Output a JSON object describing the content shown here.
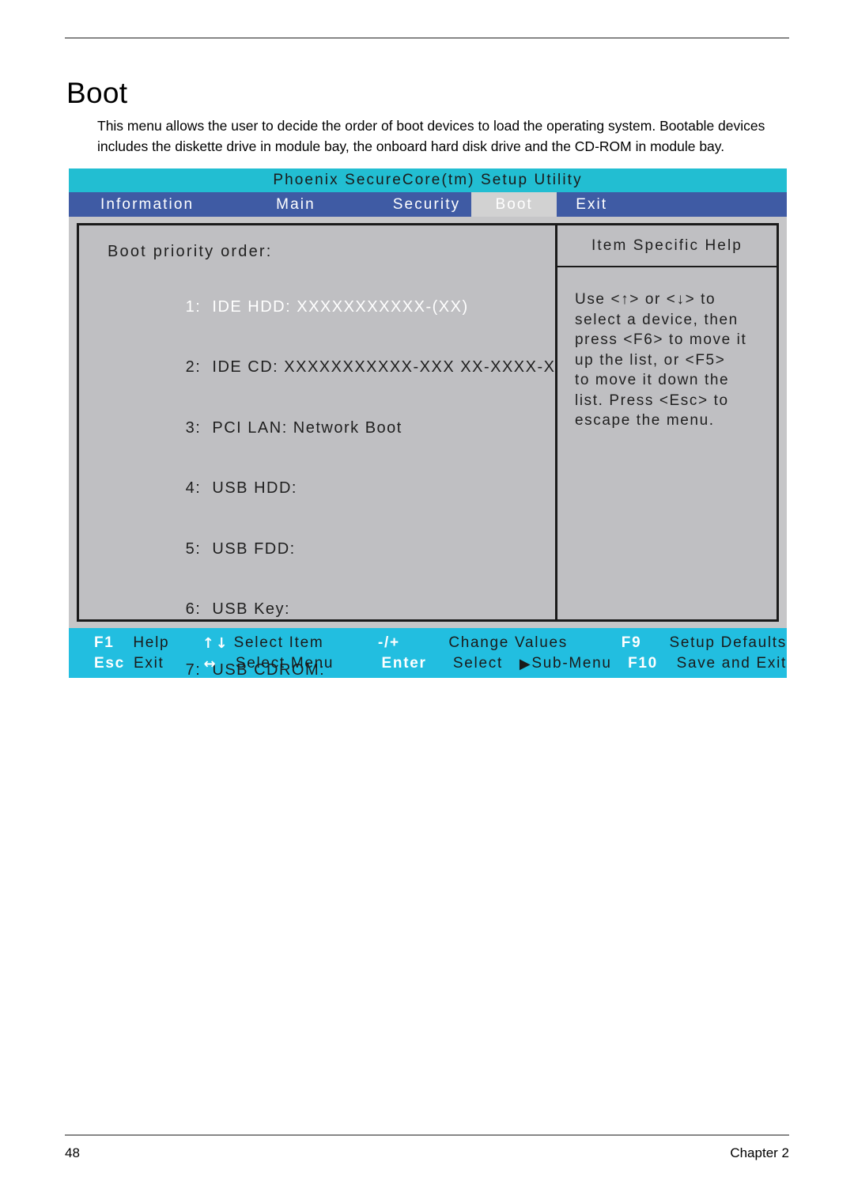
{
  "document": {
    "title": "Boot",
    "paragraph": "This menu allows the user to decide the order of boot devices to load the operating system. Bootable devices includes the diskette drive in module bay, the onboard hard disk drive and the CD-ROM in module bay.",
    "page_number": "48",
    "chapter": "Chapter 2"
  },
  "bios": {
    "title": "Phoenix SecureCore(tm) Setup Utility",
    "menu": [
      {
        "label": "Information",
        "active": false
      },
      {
        "label": "Main",
        "active": false
      },
      {
        "label": "Security",
        "active": false
      },
      {
        "label": "Boot",
        "active": true
      },
      {
        "label": "Exit",
        "active": false
      }
    ],
    "main_panel": {
      "heading": "Boot priority order:",
      "items": [
        {
          "index": "1:",
          "text": "IDE HDD: XXXXXXXXXXX-(XX)",
          "selected": true
        },
        {
          "index": "2:",
          "text": "IDE CD: XXXXXXXXXXX-XXX XX-XXXX-XX",
          "selected": false
        },
        {
          "index": "3:",
          "text": "PCI LAN: Network Boot",
          "selected": false
        },
        {
          "index": "4:",
          "text": "USB HDD:",
          "selected": false
        },
        {
          "index": "5:",
          "text": "USB FDD:",
          "selected": false
        },
        {
          "index": "6:",
          "text": "USB Key:",
          "selected": false
        },
        {
          "index": "7:",
          "text": "USB CDROM:",
          "selected": false
        }
      ]
    },
    "help_panel": {
      "header": "Item Specific Help",
      "lines": [
        "Use <↑> or <↓> to",
        "select a device, then",
        "press <F6> to move it",
        "up the list, or <F5>",
        "to move it down the",
        "list. Press <Esc> to",
        "escape the menu."
      ]
    },
    "keybar": {
      "row1": [
        {
          "key": "F1",
          "label": "Help"
        },
        {
          "key": "↑↓",
          "label": "Select Item"
        },
        {
          "key": "-/+",
          "label": "Change Values"
        },
        {
          "key": "F9",
          "label": "Setup Defaults"
        }
      ],
      "row2": [
        {
          "key": "Esc",
          "label": "Exit"
        },
        {
          "key": "↔",
          "label": "Select Menu"
        },
        {
          "key": "Enter",
          "label": "Select"
        },
        {
          "key": "▶",
          "label": "Sub-Menu"
        },
        {
          "key": "F10",
          "label": "Save and Exit"
        }
      ]
    },
    "colors": {
      "title_bar": "#22bed2",
      "menu_bar": "#3f5ba4",
      "active_tab": "#d2d2d2",
      "panel_bg": "#bfbfc2",
      "keybar": "#22bee0",
      "selected_text": "#ffffff"
    }
  }
}
